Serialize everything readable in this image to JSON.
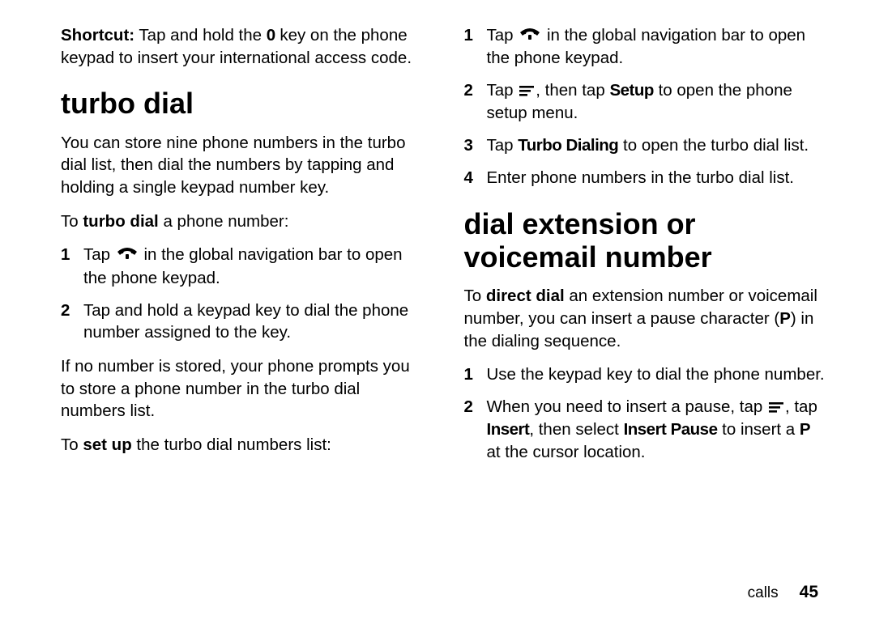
{
  "left": {
    "shortcut": {
      "label": "Shortcut:",
      "text_a": " Tap and hold the ",
      "zero": "0",
      "text_b": " key on the phone keypad to insert your international access code."
    },
    "heading": "turbo dial",
    "intro": "You can store nine phone numbers in the turbo dial list, then dial the numbers by tapping and holding a single keypad number key.",
    "to_turbo_a": "To ",
    "to_turbo_b": "turbo dial",
    "to_turbo_c": " a phone number:",
    "steps_turbo": [
      {
        "n": "1",
        "a": "Tap ",
        "b": " in the global navigation bar to open the phone keypad."
      },
      {
        "n": "2",
        "text": "Tap and hold a keypad key to dial the phone number assigned to the key."
      }
    ],
    "no_number": "If no number is stored, your phone prompts you to store a phone number in the turbo dial numbers list.",
    "to_setup_a": "To ",
    "to_setup_b": "set up",
    "to_setup_c": " the turbo dial numbers list:"
  },
  "right": {
    "setup_steps": [
      {
        "n": "1",
        "a": "Tap ",
        "b": " in the global navigation bar to open the phone keypad."
      },
      {
        "n": "2",
        "a": "Tap ",
        "b": ", then tap ",
        "setup": "Setup",
        "c": " to open the phone setup menu."
      },
      {
        "n": "3",
        "a": "Tap ",
        "td": "Turbo Dialing",
        "b": " to open the turbo dial list."
      },
      {
        "n": "4",
        "text": "Enter phone numbers in the turbo dial list."
      }
    ],
    "heading": "dial extension or voicemail number",
    "direct_a": "To ",
    "direct_b": "direct dial",
    "direct_c": " an extension number or voicemail number, you can insert a pause character (",
    "direct_P": "P",
    "direct_d": ") in the dialing sequence.",
    "dd_steps": [
      {
        "n": "1",
        "text": "Use the keypad key to dial the phone number."
      },
      {
        "n": "2",
        "a": "When you need to insert a pause, tap ",
        "b": ", tap ",
        "insert": "Insert",
        "c": ", then select ",
        "ip": "Insert Pause",
        "d": " to insert a ",
        "P": "P",
        "e": " at the cursor location."
      }
    ]
  },
  "footer": {
    "section": "calls",
    "page": "45"
  }
}
